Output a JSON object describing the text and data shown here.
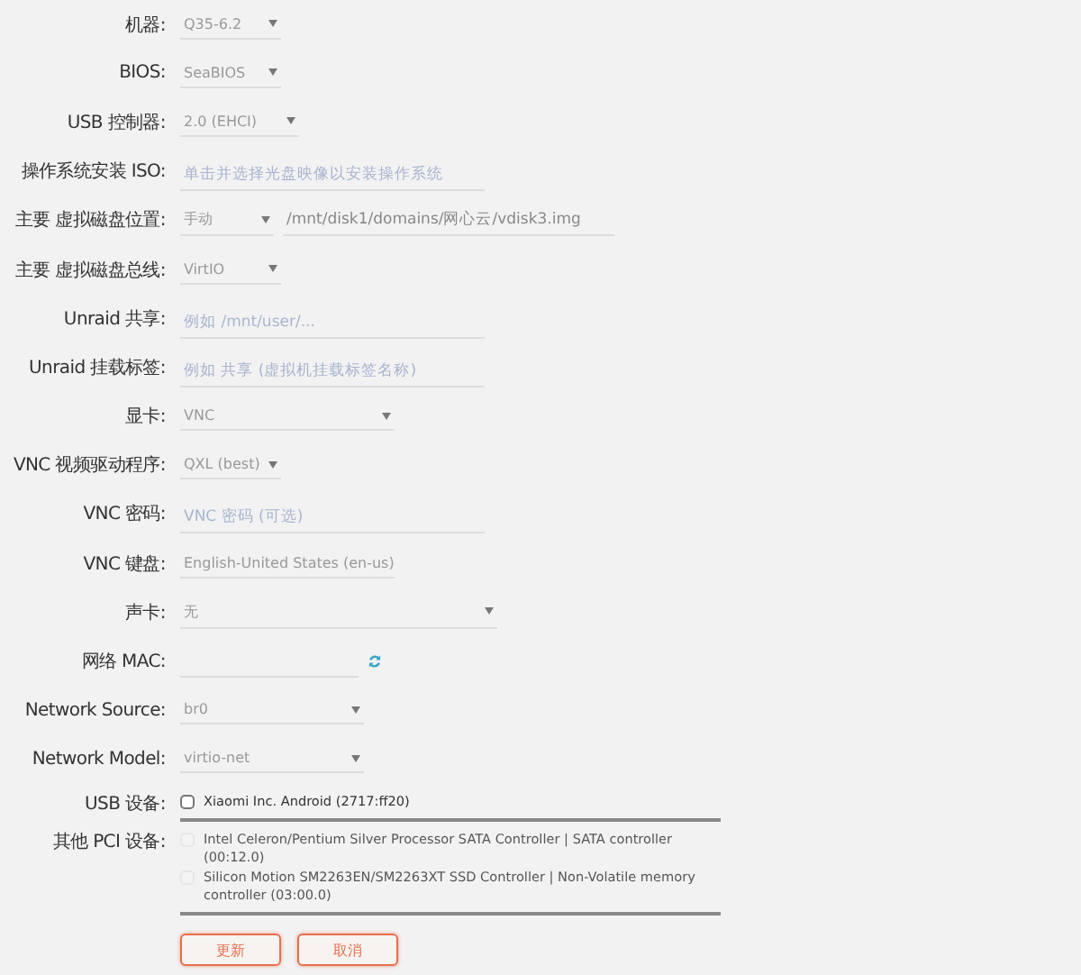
{
  "form": {
    "rows": [
      {
        "kind": "select",
        "label": "机器:",
        "value": "Q35-6.2"
      },
      {
        "kind": "select",
        "label": "BIOS:",
        "value": "SeaBIOS"
      },
      {
        "kind": "select",
        "label": "USB 控制器:",
        "value": "2.0 (EHCI)"
      },
      {
        "kind": "text",
        "label": "操作系统安装 ISO:",
        "placeholder": "单击并选择光盘映像以安装操作系统"
      },
      {
        "kind": "disk",
        "label": "主要 虚拟磁盘位置:",
        "value": "手动",
        "path": "/mnt/disk1/domains/网心云/vdisk3.img"
      },
      {
        "kind": "select",
        "label": "主要 虚拟磁盘总线:",
        "value": "VirtIO"
      },
      {
        "kind": "text",
        "label": "Unraid 共享:",
        "placeholder": "例如 /mnt/user/..."
      },
      {
        "kind": "text",
        "label": "Unraid 挂载标签:",
        "placeholder": "例如 共享 (虚拟机挂载标签名称)"
      },
      {
        "kind": "select",
        "label": "显卡:",
        "value": "VNC"
      },
      {
        "kind": "select",
        "label": "VNC 视频驱动程序:",
        "value": "QXL (best)"
      },
      {
        "kind": "text",
        "label": "VNC 密码:",
        "placeholder": "VNC 密码 (可选)"
      },
      {
        "kind": "select",
        "label": "VNC 键盘:",
        "value": "English-United States (en-us)"
      },
      {
        "kind": "select",
        "label": "声卡:",
        "value": "无"
      },
      {
        "kind": "mac",
        "label": "网络 MAC:"
      },
      {
        "kind": "select",
        "label": "Network Source:",
        "value": "br0"
      },
      {
        "kind": "select",
        "label": "Network Model:",
        "value": "virtio-net"
      },
      {
        "kind": "checks",
        "label": "USB 设备:",
        "items": [
          {
            "text": "Xiaomi Inc. Android (2717:ff20)",
            "checked": false,
            "disabled": false
          }
        ]
      },
      {
        "kind": "checks",
        "label": "其他 PCI 设备:",
        "items": [
          {
            "text": "Intel Celeron/Pentium Silver Processor SATA Controller | SATA controller (00:12.0)",
            "checked": false,
            "disabled": true
          },
          {
            "text": "Silicon Motion SM2263EN/SM2263XT SSD Controller | Non-Volatile memory controller (03:00.0)",
            "checked": false,
            "disabled": true
          }
        ]
      }
    ]
  },
  "buttons": [
    "更新",
    "取消"
  ]
}
